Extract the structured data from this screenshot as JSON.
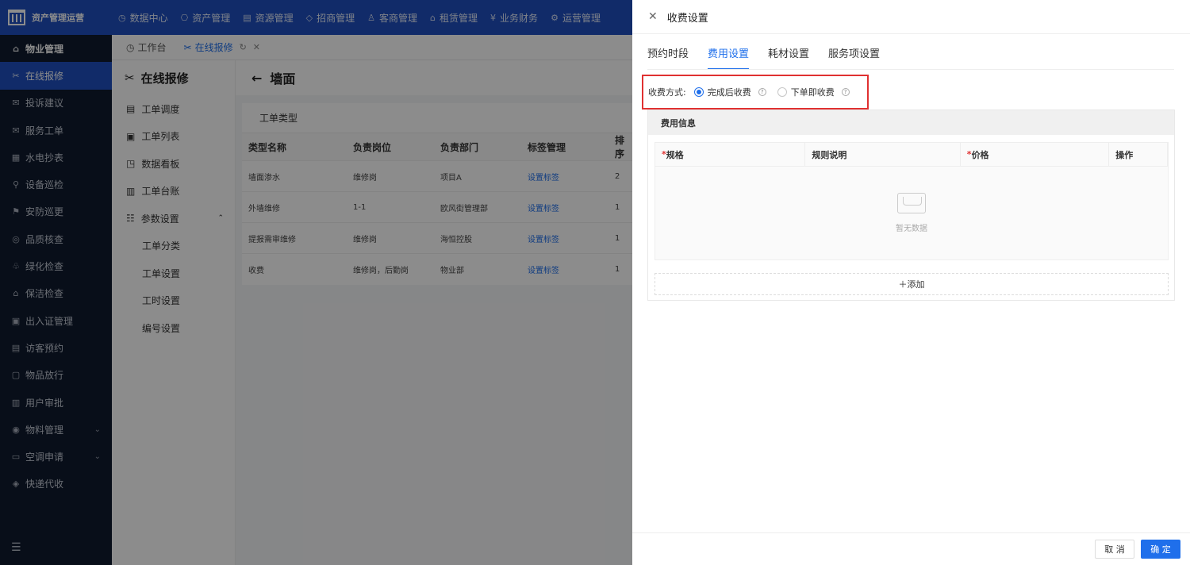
{
  "brand": {
    "title": "资产管理运营"
  },
  "top_nav": [
    {
      "icon": "◷",
      "label": "数据中心"
    },
    {
      "icon": "⎔",
      "label": "资产管理"
    },
    {
      "icon": "▤",
      "label": "资源管理"
    },
    {
      "icon": "◇",
      "label": "招商管理"
    },
    {
      "icon": "♙",
      "label": "客商管理"
    },
    {
      "icon": "⌂",
      "label": "租赁管理"
    },
    {
      "icon": "¥",
      "label": "业务财务"
    },
    {
      "icon": "⚙",
      "label": "运营管理"
    }
  ],
  "sidebar": {
    "items": [
      {
        "label": "物业管理",
        "icon": "⌂",
        "state": "strong"
      },
      {
        "label": "在线报修",
        "icon": "✂",
        "state": "active"
      },
      {
        "label": "投诉建议",
        "icon": "✉"
      },
      {
        "label": "服务工单",
        "icon": "✉"
      },
      {
        "label": "水电抄表",
        "icon": "▦"
      },
      {
        "label": "设备巡检",
        "icon": "⚲"
      },
      {
        "label": "安防巡更",
        "icon": "⚑"
      },
      {
        "label": "品质核查",
        "icon": "◎"
      },
      {
        "label": "绿化检查",
        "icon": "♧"
      },
      {
        "label": "保洁检查",
        "icon": "⌂"
      },
      {
        "label": "出入证管理",
        "icon": "▣"
      },
      {
        "label": "访客预约",
        "icon": "▤"
      },
      {
        "label": "物品放行",
        "icon": "▢"
      },
      {
        "label": "用户审批",
        "icon": "▥"
      },
      {
        "label": "物料管理",
        "icon": "◉",
        "chevron": "⌄"
      },
      {
        "label": "空调申请",
        "icon": "▭",
        "chevron": "⌄"
      },
      {
        "label": "快递代收",
        "icon": "◈"
      }
    ],
    "footer_icon": "☰"
  },
  "tabs": [
    {
      "label": "工作台",
      "icon": "◷"
    },
    {
      "label": "在线报修",
      "icon": "✂",
      "active": true
    }
  ],
  "submenu": {
    "title": "在线报修",
    "items": [
      {
        "label": "工单调度",
        "icon": "▤"
      },
      {
        "label": "工单列表",
        "icon": "▣"
      },
      {
        "label": "数据看板",
        "icon": "◳"
      },
      {
        "label": "工单台账",
        "icon": "▥"
      },
      {
        "label": "参数设置",
        "icon": "☷",
        "chevron": "⌃"
      },
      {
        "label": "工单分类",
        "child": true
      },
      {
        "label": "工单设置",
        "child": true
      },
      {
        "label": "工时设置",
        "child": true
      },
      {
        "label": "编号设置",
        "child": true
      }
    ]
  },
  "main": {
    "back_title": "墙面",
    "card_title": "工单类型",
    "columns": [
      "类型名称",
      "负责岗位",
      "负责部门",
      "标签管理",
      "排序"
    ],
    "rows": [
      [
        "墙面渗水",
        "维修岗",
        "项目A",
        "设置标签",
        "2"
      ],
      [
        "外墙维修",
        "1-1",
        "欧风街管理部",
        "设置标签",
        "1"
      ],
      [
        "提报需审维修",
        "维修岗",
        "海恒控股",
        "设置标签",
        "1"
      ],
      [
        "收费",
        "维修岗，后勤岗",
        "物业部",
        "设置标签",
        "1"
      ]
    ]
  },
  "drawer": {
    "title": "收费设置",
    "tabs": [
      "预约时段",
      "费用设置",
      "耗材设置",
      "服务项设置"
    ],
    "active_tab": 1,
    "fee_mode_label": "收费方式:",
    "options": [
      "完成后收费",
      "下单即收费"
    ],
    "selected_option": 0,
    "info_title": "费用信息",
    "info_columns": [
      {
        "label": "规格",
        "required": true
      },
      {
        "label": "规则说明",
        "required": false
      },
      {
        "label": "价格",
        "required": true
      },
      {
        "label": "操作",
        "required": false
      }
    ],
    "empty_text": "暂无数据",
    "add_label": "＋添加",
    "cancel_label": "取 消",
    "ok_label": "确 定"
  }
}
